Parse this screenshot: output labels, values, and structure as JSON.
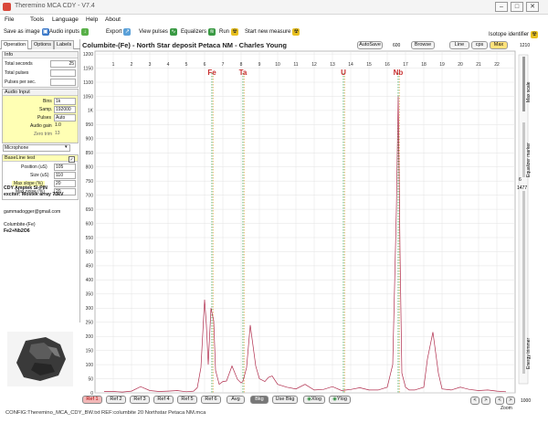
{
  "window": {
    "title": "Theremino MCA CDY - V7.4",
    "minimize": "–",
    "maximize": "□",
    "close": "✕"
  },
  "menu": [
    "File",
    "Tools",
    "Language",
    "Help",
    "About"
  ],
  "toolbar": {
    "save_image": "Save as image",
    "audio_inputs": "Audio inputs",
    "export": "Export",
    "view_pulses": "View pulses",
    "equalizers": "Equalizers",
    "run": "Run",
    "start_new": "Start new measure",
    "isotope": "Isotope identifier"
  },
  "tabs": [
    "Operation",
    "Options",
    "Labels"
  ],
  "info": {
    "header": "Info",
    "total_seconds_label": "Total seconds",
    "total_seconds": "25",
    "total_pulses_label": "Total pulses",
    "total_pulses": "",
    "pulses_sec_label": "Pulses per sec.",
    "pulses_sec": ""
  },
  "audio": {
    "header": "Audio Input",
    "bins_label": "Bins",
    "bins": "1k",
    "samp_label": "Samp.",
    "samp": "192000",
    "pulses_label": "Pulses",
    "pulses": "Auto",
    "gain_label": "Audio gain",
    "gain": "1.0",
    "zero_label": "Zero trim",
    "zero": "13",
    "device": "Microphone"
  },
  "baseline": {
    "header": "BaseLine test",
    "checked": "✓",
    "position_label": "Position (uS)",
    "position": "105",
    "size_label": "Size (uS)",
    "size": "110",
    "maxslope_label": "Max slope (%)",
    "maxslope": "20",
    "maxnoise_label": "Max noise (%)",
    "maxnoise": "20"
  },
  "notes": {
    "line1": "CDY Amptek Si-PIN",
    "line2": "exciter: Mostek array 70kV",
    "email": "gammadogger@gmail.com",
    "sample": "Columbite-(Fe)",
    "formula": "Fe2+Nb2O6"
  },
  "chart_header": {
    "title": "Columbite-(Fe) - North Star deposit Petaca NM - Charles Young",
    "autosave": "AutoSave",
    "value_600": "600",
    "browse": "Browse",
    "line": "Line",
    "cps": "cps",
    "max": "Max",
    "right_top": "1210"
  },
  "side_labels": {
    "max_scale": "Max scale",
    "equalizer_marker": "Equalizer marker",
    "energy_trimmer": "Energy trimmer",
    "zoom": "Zoom",
    "val_1477": "1477",
    "val_6": "6",
    "val_1000": "1000"
  },
  "bottom": {
    "refs": [
      "Ref 1",
      "Ref 2",
      "Ref 3",
      "Ref 4",
      "Ref 5",
      "Ref 6"
    ],
    "avg": "Avg",
    "bkg": "Bkg",
    "use_bkg": "Use Bkg",
    "xlog": "Xlog",
    "ylog": "Ylog",
    "nav": [
      "<",
      ">",
      "<",
      ">"
    ]
  },
  "status": "CONFIG:Theremino_MCA_CDY_BW.txt REF:columbite 20 Northstar Petaca NM.mca",
  "colors": {
    "spectrum": "#b02c4c",
    "grid": "#e2e2e2",
    "orange_marker": "#e8a040",
    "green_marker": "#38a048",
    "element_label": "#c83030",
    "yellow": "#ffffb4"
  },
  "chart_data": {
    "type": "line",
    "xlabel": "",
    "ylabel": "",
    "xlim": [
      0,
      23
    ],
    "ylim": [
      0,
      1210
    ],
    "x_ticks": [
      1,
      2,
      3,
      4,
      5,
      6,
      7,
      8,
      9,
      10,
      11,
      12,
      13,
      14,
      15,
      16,
      17,
      18,
      19,
      20,
      21,
      22
    ],
    "y_ticks": [
      0,
      50,
      100,
      150,
      200,
      250,
      300,
      350,
      400,
      450,
      500,
      550,
      600,
      650,
      700,
      750,
      800,
      850,
      900,
      950,
      "1K",
      1050,
      1100,
      1150,
      1200
    ],
    "element_labels": [
      {
        "label": "Fe",
        "x": 6.4
      },
      {
        "label": "Ta",
        "x": 8.1
      },
      {
        "label": "U",
        "x": 13.6
      },
      {
        "label": "Nb",
        "x": 16.6
      }
    ],
    "series": [
      {
        "x": [
          0.5,
          1,
          1.5,
          2,
          2.5,
          3,
          3.5,
          4,
          4.5,
          5,
          5.4,
          5.6,
          5.8,
          6,
          6.1,
          6.2,
          6.35,
          6.5,
          6.6,
          6.8,
          7,
          7.2,
          7.5,
          7.8,
          8,
          8.1,
          8.3,
          8.5,
          8.8,
          9,
          9.3,
          9.5,
          9.7,
          10,
          10.5,
          11,
          11.5,
          12,
          12.5,
          13,
          13.5,
          14,
          14.5,
          15,
          15.5,
          16,
          16.3,
          16.5,
          16.6,
          16.7,
          16.8,
          17,
          17.2,
          17.5,
          18,
          18.2,
          18.5,
          18.8,
          19,
          19.5,
          20,
          20.5,
          21,
          21.5,
          22,
          22.5
        ],
        "y": [
          5,
          5,
          3,
          6,
          22,
          8,
          5,
          6,
          8,
          4,
          6,
          18,
          90,
          330,
          240,
          100,
          300,
          255,
          80,
          30,
          40,
          42,
          95,
          48,
          35,
          40,
          90,
          240,
          95,
          50,
          40,
          55,
          60,
          30,
          20,
          14,
          30,
          10,
          12,
          22,
          8,
          12,
          18,
          10,
          10,
          20,
          100,
          650,
          1050,
          500,
          70,
          20,
          10,
          10,
          20,
          120,
          215,
          70,
          14,
          10,
          20,
          12,
          8,
          10,
          6,
          4
        ]
      }
    ]
  }
}
